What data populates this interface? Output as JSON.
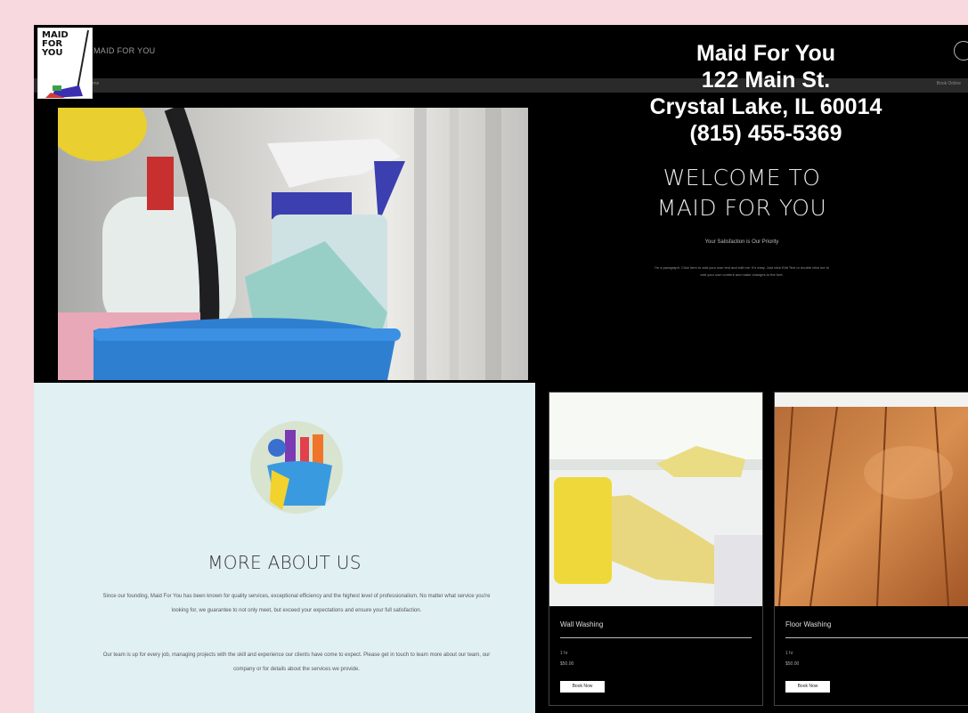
{
  "header": {
    "site_name": "MAID FOR YOU",
    "nav_left": "Home",
    "nav_right": "Book Online"
  },
  "logo": {
    "text": "MAID\nFOR\nYOU"
  },
  "overlay": {
    "name": "Maid For You",
    "street": "122 Main St.",
    "city": "Crystal Lake, IL 60014",
    "phone": "(815) 455-5369"
  },
  "hero": {
    "welcome_title": "WELCOME TO MAID FOR YOU",
    "tagline": "Your Satisfaction is Our Priority",
    "blurb": "I'm a paragraph. Click here to add your own text and edit me. It's easy. Just click Edit Text or double click me to add your own content and make changes to the font."
  },
  "about": {
    "title": "MORE ABOUT US",
    "paragraph_1": "Since our founding, Maid For You has been known for quality services, exceptional efficiency and the highest level of professionalism. No matter what service you're looking for, we guarantee to not only meet, but exceed your expectations and ensure your full satisfaction.",
    "paragraph_2": "Our team is up for every job, managing projects with the skill and experience our clients have come to expect. Please get in touch to learn more about our team, our company or for details about the services we provide."
  },
  "services": [
    {
      "title": "Wall Washing",
      "duration": "1 hr",
      "price": "$50.00",
      "button": "Book Now"
    },
    {
      "title": "Floor Washing",
      "duration": "1 hr",
      "price": "$50.00",
      "button": "Book Now"
    }
  ],
  "colors": {
    "page_bg": "#f7d9df",
    "site_bg": "#000000",
    "about_bg": "#e1f0f3",
    "bucket_blue": "#2f7fd1"
  }
}
